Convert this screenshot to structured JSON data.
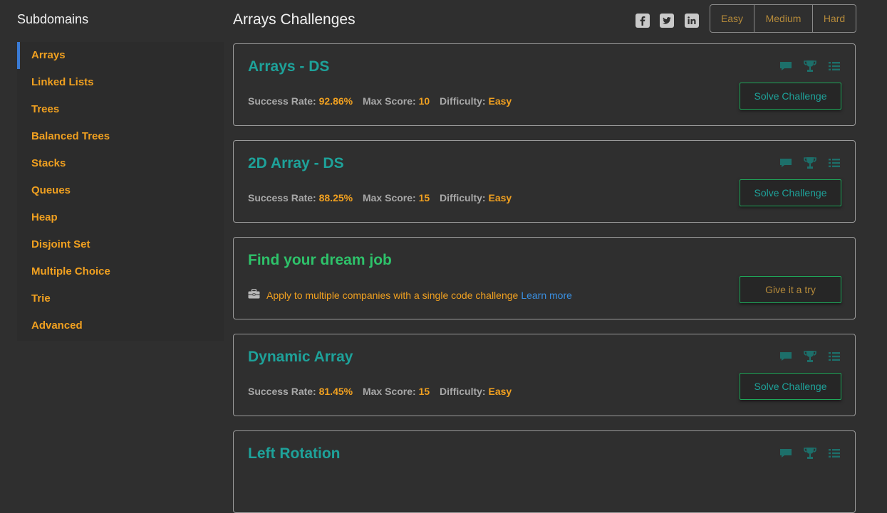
{
  "sidebar": {
    "title": "Subdomains",
    "items": [
      {
        "label": "Arrays",
        "active": true
      },
      {
        "label": "Linked Lists"
      },
      {
        "label": "Trees"
      },
      {
        "label": "Balanced Trees"
      },
      {
        "label": "Stacks"
      },
      {
        "label": "Queues"
      },
      {
        "label": "Heap"
      },
      {
        "label": "Disjoint Set"
      },
      {
        "label": "Multiple Choice"
      },
      {
        "label": "Trie"
      },
      {
        "label": "Advanced"
      }
    ]
  },
  "header": {
    "title": "Arrays Challenges",
    "social": [
      "facebook-icon",
      "twitter-icon",
      "linkedin-icon"
    ],
    "difficulty_filters": [
      "Easy",
      "Medium",
      "Hard"
    ]
  },
  "labels": {
    "success_rate": "Success Rate:",
    "max_score": "Max Score:",
    "difficulty": "Difficulty:"
  },
  "challenges": [
    {
      "title": "Arrays - DS",
      "success_rate": "92.86%",
      "max_score": "10",
      "difficulty": "Easy",
      "button": "Solve Challenge"
    },
    {
      "title": "2D Array - DS",
      "success_rate": "88.25%",
      "max_score": "15",
      "difficulty": "Easy",
      "button": "Solve Challenge"
    },
    {
      "title": "Dynamic Array",
      "success_rate": "81.45%",
      "max_score": "15",
      "difficulty": "Easy",
      "button": "Solve Challenge"
    },
    {
      "title": "Left Rotation"
    }
  ],
  "job_promo": {
    "title": "Find your dream job",
    "text": "Apply to multiple companies with a single code challenge",
    "link": "Learn more",
    "button": "Give it a try"
  },
  "colors": {
    "accent_orange": "#f0a020",
    "challenge_teal": "#1ea29a",
    "job_green": "#2ec26a",
    "active_blue": "#3a7bd5",
    "link_blue": "#3a8fe0"
  },
  "icons": [
    "discussion-icon",
    "leaderboard-icon",
    "submissions-icon",
    "briefcase-icon"
  ]
}
